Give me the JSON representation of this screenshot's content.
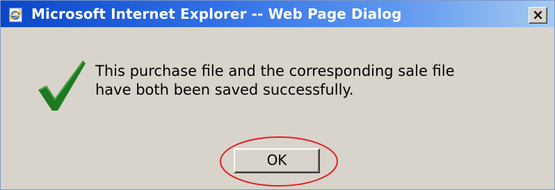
{
  "window": {
    "title": "Microsoft Internet Explorer -- Web Page Dialog",
    "close_label": "×"
  },
  "dialog": {
    "message_lines": [
      "This purchase file and the corresponding sale file",
      "have both been saved successfully."
    ],
    "ok_label": "OK"
  },
  "icons": {
    "title": "internet-explorer-icon",
    "status": "checkmark-icon"
  },
  "colors": {
    "titlebar_start": "#0a46c8",
    "titlebar_end": "#a6caf0",
    "dialog_bg": "#d8d4cc",
    "checkmark": "#1e7a1e",
    "highlight_ellipse": "#e02020"
  }
}
